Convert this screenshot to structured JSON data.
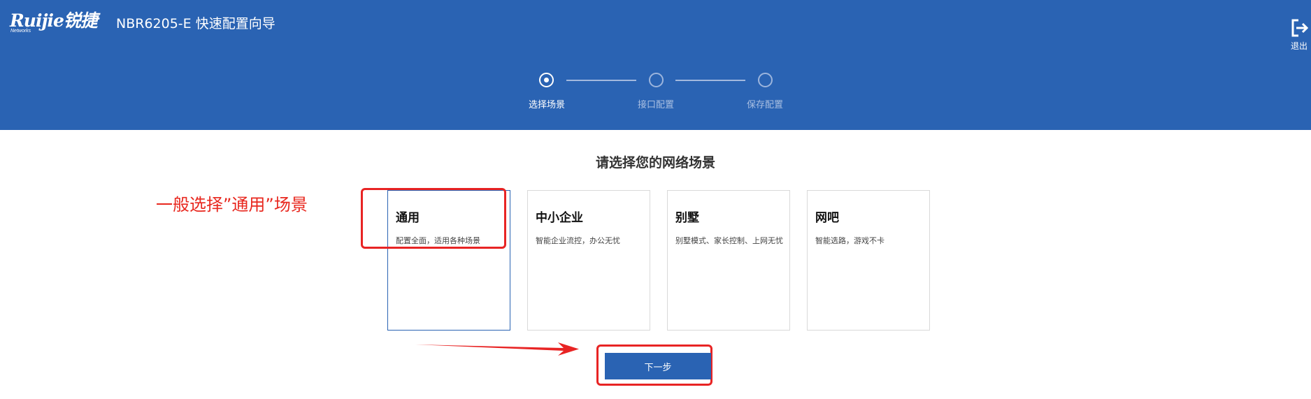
{
  "header": {
    "logo_text": "Ruijie锐捷",
    "logo_subtext": "Networks",
    "title": "NBR6205-E  快速配置向导",
    "logout_label": "退出",
    "logout_icon": "logout-icon"
  },
  "steps": [
    {
      "label": "选择场景",
      "state": "active"
    },
    {
      "label": "接口配置",
      "state": "inactive"
    },
    {
      "label": "保存配置",
      "state": "inactive"
    }
  ],
  "main": {
    "title": "请选择您的网络场景",
    "annotation": "一般选择”通用”场景",
    "cards": [
      {
        "title": "通用",
        "desc": "配置全面，适用各种场景",
        "selected": true
      },
      {
        "title": "中小企业",
        "desc": "智能企业流控，办公无忧",
        "selected": false
      },
      {
        "title": "别墅",
        "desc": "别墅模式、家长控制、上网无忧",
        "selected": false
      },
      {
        "title": "网吧",
        "desc": "智能选路，游戏不卡",
        "selected": false
      }
    ],
    "next_label": "下一步"
  },
  "colors": {
    "header_bg": "#2a63b3",
    "annotation_red": "#e8281f",
    "button_bg": "#2a63b3"
  }
}
